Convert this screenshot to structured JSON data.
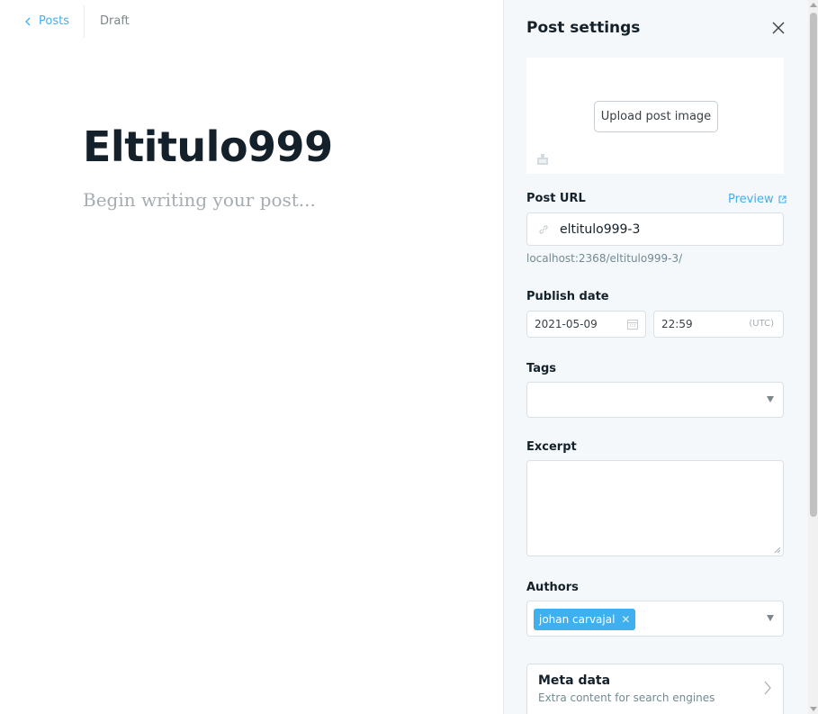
{
  "topbar": {
    "back_label": "Posts",
    "status": "Draft"
  },
  "editor": {
    "title": "Eltitulo999",
    "body_placeholder": "Begin writing your post..."
  },
  "panel": {
    "title": "Post settings",
    "upload_label": "Upload post image",
    "post_url_label": "Post URL",
    "preview_label": "Preview",
    "slug": "eltitulo999-3",
    "url_hint": "localhost:2368/eltitulo999-3/",
    "publish_date_label": "Publish date",
    "publish_date": "2021-05-09",
    "publish_time": "22:59",
    "timezone": "(UTC)",
    "tags_label": "Tags",
    "excerpt_label": "Excerpt",
    "authors_label": "Authors",
    "author_name": "johan carvajal",
    "meta_title": "Meta data",
    "meta_subtitle": "Extra content for search engines"
  },
  "colors": {
    "accent": "#3eb0ef",
    "panel_bg": "#f4f8fb",
    "text": "#15212a",
    "muted": "#738a94"
  }
}
